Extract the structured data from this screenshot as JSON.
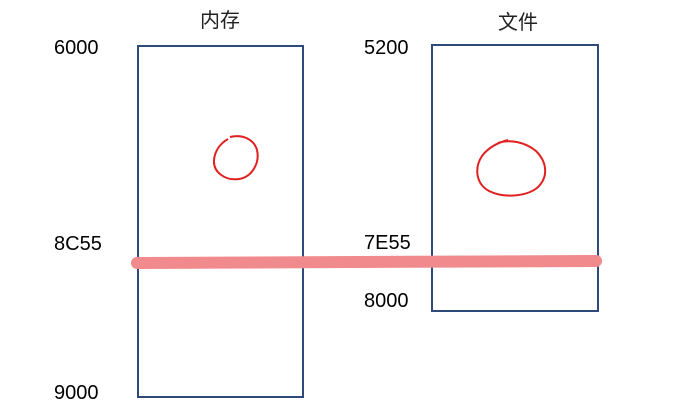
{
  "memory": {
    "title": "内存",
    "addr_start": "6000",
    "addr_mid": "8C55",
    "addr_end": "9000"
  },
  "file": {
    "title": "文件",
    "addr_start": "5200",
    "addr_mid": "7E55",
    "addr_end": "8000"
  },
  "colors": {
    "box_border": "#2e4a7a",
    "mapping_line": "#f08a8c",
    "circle_marks": "#e0201f"
  }
}
